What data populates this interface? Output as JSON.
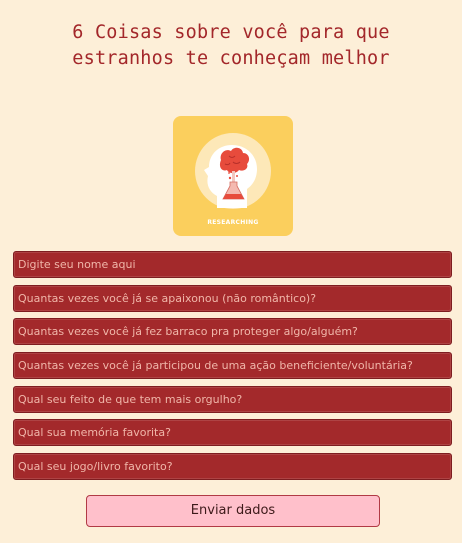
{
  "page": {
    "title_line1": "6 Coisas sobre você para que",
    "title_line2": "estranhos te conheçam melhor"
  },
  "thumbnail": {
    "caption": "RESEARCHING",
    "icon": "head-brain-flask-icon",
    "background": "#fbcf5d"
  },
  "form": {
    "fields": [
      {
        "placeholder": "Digite seu nome aqui"
      },
      {
        "placeholder": "Quantas vezes você já se apaixonou (não romântico)?"
      },
      {
        "placeholder": "Quantas vezes você já fez barraco pra proteger algo/alguém?"
      },
      {
        "placeholder": "Quantas vezes você já participou de uma ação beneficiente/voluntária?"
      },
      {
        "placeholder": "Qual seu feito de que tem mais orgulho?"
      },
      {
        "placeholder": "Qual sua memória favorita?"
      },
      {
        "placeholder": "Qual seu jogo/livro favorito?"
      }
    ],
    "submit_label": "Enviar dados"
  },
  "colors": {
    "background": "#fdefd8",
    "title": "#a3272a",
    "field_bg": "#a3292b",
    "field_text": "#f0b6a9",
    "button_bg": "#ffc0cb"
  }
}
